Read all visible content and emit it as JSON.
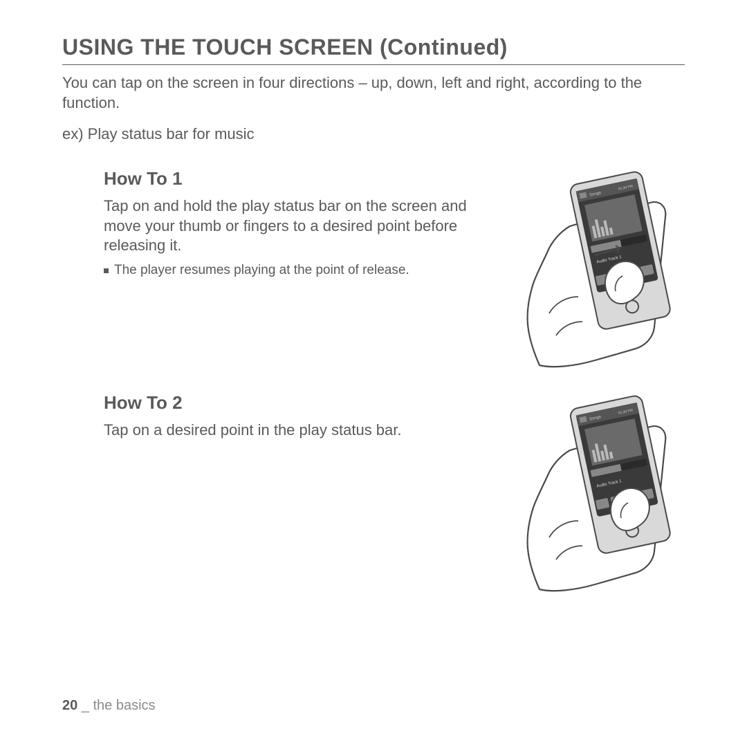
{
  "title": "USING THE TOUCH SCREEN (Continued)",
  "intro": "You can tap on the screen in four directions – up, down, left and right, according to the function.",
  "example": "ex) Play status bar for music",
  "howto1": {
    "heading": "How To 1",
    "body": "Tap on and hold the play status bar on the screen and move your thumb or fingers to a desired point before releasing it.",
    "bullet": "The player resumes playing at the point of release."
  },
  "howto2": {
    "heading": "How To 2",
    "body": "Tap on a desired point in the play status bar."
  },
  "footer": {
    "page_number": "20",
    "separator": " _ ",
    "section": "the basics"
  }
}
